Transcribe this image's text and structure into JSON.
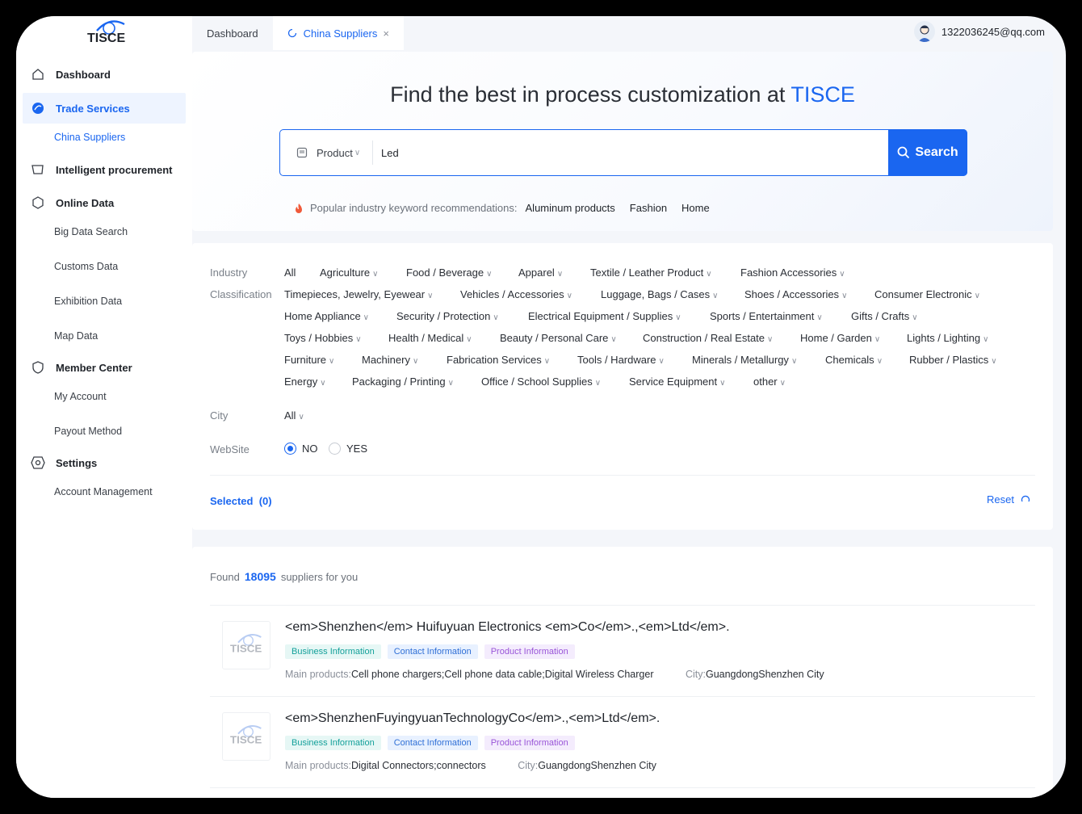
{
  "logo": {
    "text": "TISCE"
  },
  "sidebar": {
    "items": [
      {
        "label": "Dashboard",
        "icon": "home-icon"
      },
      {
        "label": "Trade Services",
        "icon": "trade-icon"
      },
      {
        "label": "China Suppliers"
      },
      {
        "label": "Intelligent procurement",
        "icon": "basket-icon"
      },
      {
        "label": "Online Data",
        "icon": "hexagon-icon"
      },
      {
        "label": "Big Data Search"
      },
      {
        "label": "Customs Data"
      },
      {
        "label": "Exhibition Data"
      },
      {
        "label": "Map Data"
      },
      {
        "label": "Member Center",
        "icon": "shield-icon"
      },
      {
        "label": "My Account"
      },
      {
        "label": "Payout Method"
      },
      {
        "label": "Settings",
        "icon": "gear-icon"
      },
      {
        "label": "Account Management"
      }
    ]
  },
  "tabs": [
    {
      "label": "Dashboard"
    },
    {
      "label": "China Suppliers",
      "close": "×"
    }
  ],
  "user": {
    "email": "1322036245@qq.com"
  },
  "hero": {
    "title_prefix": "Find the best in process customization at ",
    "title_brand": "TISCE",
    "search_type": "Product",
    "search_value": "Led",
    "search_button": "Search",
    "popular_label": "Popular industry keyword recommendations:",
    "keywords": [
      "Aluminum products",
      "Fashion",
      "Home"
    ]
  },
  "filters": {
    "industry_label": "Industry",
    "classification_label": "Classification",
    "categories": [
      "All",
      "Agriculture",
      "Food / Beverage",
      "Apparel",
      "Textile / Leather Product",
      "Fashion Accessories",
      "Timepieces, Jewelry, Eyewear",
      "Vehicles / Accessories",
      "Luggage, Bags / Cases",
      "Shoes / Accessories",
      "Consumer Electronic",
      "Home Appliance",
      "Security / Protection",
      "Electrical Equipment / Supplies",
      "Sports / Entertainment",
      "Gifts / Crafts",
      "Toys / Hobbies",
      "Health / Medical",
      "Beauty / Personal Care",
      "Construction / Real Estate",
      "Home / Garden",
      "Lights / Lighting",
      "Furniture",
      "Machinery",
      "Fabrication Services",
      "Tools / Hardware",
      "Minerals / Metallurgy",
      "Chemicals",
      "Rubber / Plastics",
      "Energy",
      "Packaging / Printing",
      "Office / School Supplies",
      "Service Equipment",
      "other"
    ],
    "chevron": "∨",
    "city_label": "City",
    "city_value": "All",
    "website_label": "WebSite",
    "website_no": "NO",
    "website_yes": "YES",
    "website_selected": "NO",
    "selected_label": "Selected",
    "selected_count": "(0)",
    "reset_label": "Reset"
  },
  "results": {
    "found_prefix": "Found",
    "count": "18095",
    "found_suffix": "suppliers for you",
    "items": [
      {
        "name": "<em>Shenzhen</em> Huifuyuan Electronics <em>Co</em>.,<em>Ltd</em>.",
        "tags": [
          "Business Information",
          "Contact Information",
          "Product Information"
        ],
        "main_label": "Main products:",
        "main_value": "Cell phone chargers;Cell phone data cable;Digital Wireless Charger",
        "city_label": "City:",
        "city_value": "GuangdongShenzhen City"
      },
      {
        "name": "<em>ShenzhenFuyingyuanTechnologyCo</em>.,<em>Ltd</em>.",
        "tags": [
          "Business Information",
          "Contact Information",
          "Product Information"
        ],
        "main_label": "Main products:",
        "main_value": "Digital Connectors;connectors",
        "city_label": "City:",
        "city_value": "GuangdongShenzhen City"
      }
    ]
  },
  "colors": {
    "accent": "#1a66f0",
    "background": "#f4f6fa"
  }
}
